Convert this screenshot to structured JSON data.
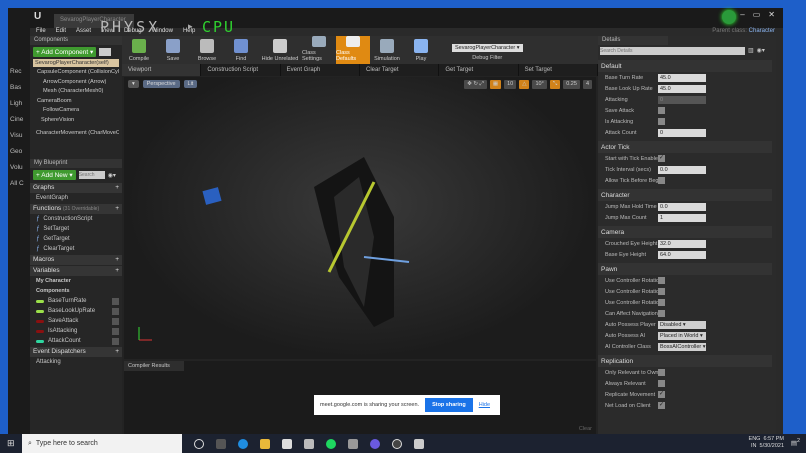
{
  "back_window": {
    "labels": [
      "Rec",
      "Bas",
      "Ligh",
      "Cine",
      "Visu",
      "Geo",
      "Volu",
      "All C"
    ]
  },
  "window": {
    "doc_tab": "SevarogPlayerCharacter",
    "overlay_physx": "PHYSX",
    "overlay_cpu": "CPU",
    "parent_class_label": "Parent class:",
    "parent_class": "Character",
    "win_buttons": [
      "–",
      "▭",
      "✕"
    ]
  },
  "menu": [
    "File",
    "Edit",
    "Asset",
    "View",
    "Debug",
    "Window",
    "Help"
  ],
  "toolbar": {
    "buttons": [
      "Compile",
      "Save",
      "Browse",
      "Find",
      "Hide Unrelated",
      "Class Settings",
      "Class Defaults",
      "Simulation",
      "Play"
    ],
    "debug_selected": "SevarogPlayerCharacter ▾",
    "debug_label": "Debug Filter",
    "active": "Class Defaults"
  },
  "components": {
    "title": "Components",
    "add_button": "+ Add Component ▾",
    "self": "SevarogPlayerCharacter(self)",
    "items": [
      "CapsuleComponent (CollisionCylinder)",
      "ArrowComponent (Arrow)",
      "Mesh (CharacterMesh0)",
      "CameraBoom",
      "FollowCamera",
      "SphereVision",
      "CharacterMovement (CharMoveComp)"
    ]
  },
  "my_blueprint": {
    "title": "My Blueprint",
    "add_new": "+ Add New ▾",
    "search_placeholder": "Search",
    "graphs": "Graphs",
    "event_graph": "EventGraph",
    "functions": "Functions",
    "functions_count": "(31 Overridable)",
    "function_items": [
      "ConstructionScript",
      "SetTarget",
      "GetTarget",
      "ClearTarget"
    ],
    "macros": "Macros",
    "variables": "Variables",
    "var_groups": [
      "My Character",
      "Components"
    ],
    "variable_items": [
      {
        "name": "BaseTurnRate",
        "color": "#9be04a"
      },
      {
        "name": "BaseLookUpRate",
        "color": "#9be04a"
      },
      {
        "name": "SaveAttack",
        "color": "#8a1010"
      },
      {
        "name": "IsAttacking",
        "color": "#8a1010"
      },
      {
        "name": "AttackCount",
        "color": "#2ed6a0"
      }
    ],
    "dispatchers": "Event Dispatchers",
    "dispatcher_items": [
      "Attacking"
    ]
  },
  "editor_tabs": [
    "Viewport",
    "Construction Script",
    "Event Graph",
    "Clear Target",
    "Get Target",
    "Set Target"
  ],
  "viewport": {
    "view_mode": "Perspective",
    "lit": "Lit",
    "snap_grid": "10",
    "snap_rot": "10°",
    "snap_scale": "0.25",
    "cam_speed": "4"
  },
  "compiler": {
    "title": "Compiler Results",
    "clear": "Clear"
  },
  "share_notice": {
    "text": "meet.google.com is sharing your screen.",
    "stop": "Stop sharing",
    "hide": "Hide"
  },
  "details": {
    "title": "Details",
    "search_placeholder": "Search Details",
    "sections": [
      {
        "name": "Default",
        "rows": [
          {
            "label": "Base Turn Rate",
            "type": "num",
            "value": "45.0"
          },
          {
            "label": "Base Look Up Rate",
            "type": "num",
            "value": "45.0"
          },
          {
            "label": "Attacking",
            "type": "dis",
            "value": "0"
          },
          {
            "label": "Save Attack",
            "type": "cb",
            "value": ""
          },
          {
            "label": "Is Attacking",
            "type": "cb",
            "value": ""
          },
          {
            "label": "Attack Count",
            "type": "num",
            "value": "0"
          }
        ]
      },
      {
        "name": "Actor Tick",
        "rows": [
          {
            "label": "Start with Tick Enabled",
            "type": "cb",
            "value": "✓"
          },
          {
            "label": "Tick Interval (secs)",
            "type": "num",
            "value": "0.0"
          },
          {
            "label": "Allow Tick Before Begin Play",
            "type": "cb",
            "value": ""
          }
        ]
      },
      {
        "name": "Character",
        "rows": [
          {
            "label": "Jump Max Hold Time",
            "type": "num",
            "value": "0.0"
          },
          {
            "label": "Jump Max Count",
            "type": "num",
            "value": "1"
          }
        ]
      },
      {
        "name": "Camera",
        "rows": [
          {
            "label": "Crouched Eye Height",
            "type": "num",
            "value": "32.0"
          },
          {
            "label": "Base Eye Height",
            "type": "num",
            "value": "64.0"
          }
        ]
      },
      {
        "name": "Pawn",
        "rows": [
          {
            "label": "Use Controller Rotation Pitch",
            "type": "cb",
            "value": ""
          },
          {
            "label": "Use Controller Rotation Yaw",
            "type": "cb",
            "value": ""
          },
          {
            "label": "Use Controller Rotation Roll",
            "type": "cb",
            "value": ""
          },
          {
            "label": "Can Affect Navigation Generation",
            "type": "cb",
            "value": ""
          },
          {
            "label": "Auto Possess Player",
            "type": "dd",
            "value": "Disabled ▾"
          },
          {
            "label": "Auto Possess AI",
            "type": "dd",
            "value": "Placed in World ▾"
          },
          {
            "label": "AI Controller Class",
            "type": "dd",
            "value": "BossAIController ▾"
          }
        ]
      },
      {
        "name": "Replication",
        "rows": [
          {
            "label": "Only Relevant to Owner",
            "type": "cb",
            "value": ""
          },
          {
            "label": "Always Relevant",
            "type": "cb",
            "value": ""
          },
          {
            "label": "Replicate Movement",
            "type": "cb",
            "value": "✓"
          },
          {
            "label": "Net Load on Client",
            "type": "cb",
            "value": "✓"
          }
        ]
      }
    ]
  },
  "taskbar": {
    "search_placeholder": "Type here to search",
    "lang": "ENG",
    "region": "IN",
    "time": "6:57 PM",
    "date": "5/30/2021",
    "notif_count": "2"
  }
}
